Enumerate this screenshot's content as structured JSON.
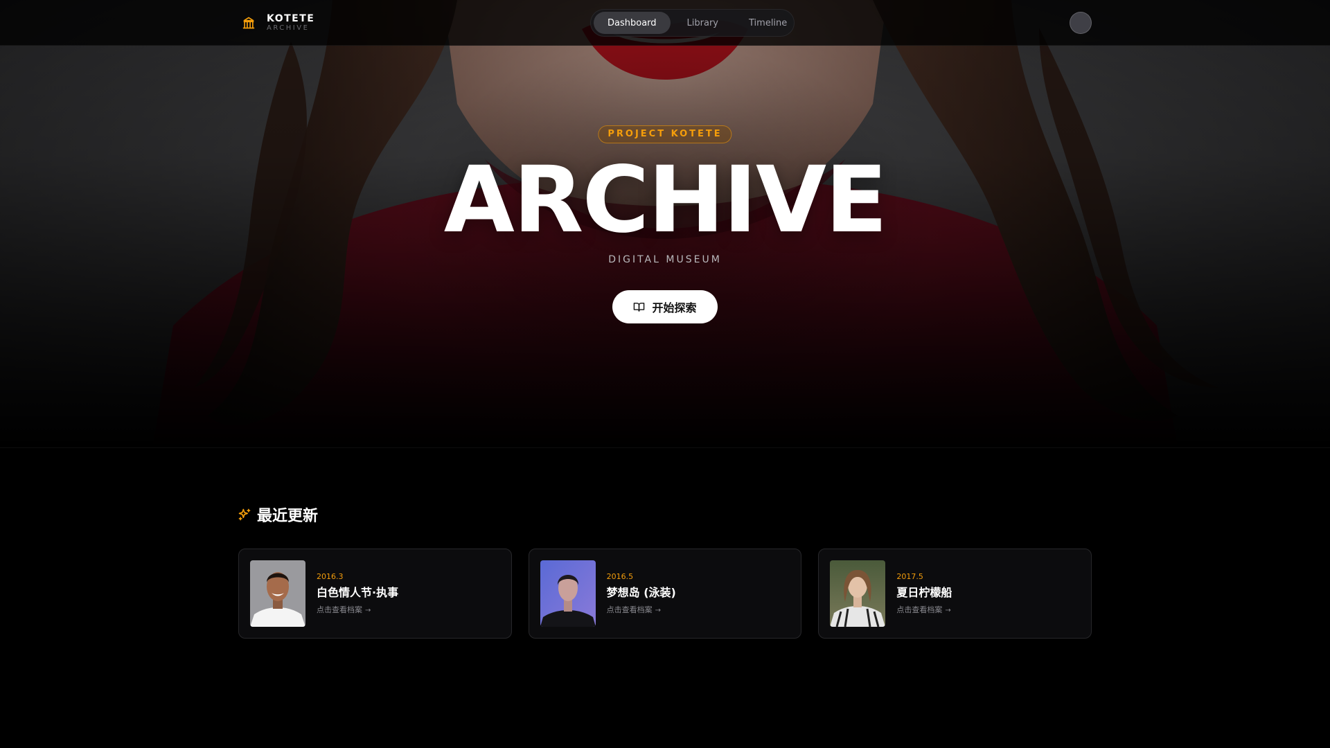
{
  "brand": {
    "name": "KOTETE",
    "subtitle": "ARCHIVE",
    "logo_icon": "library-icon"
  },
  "nav": {
    "tabs": [
      {
        "label": "Dashboard",
        "active": true
      },
      {
        "label": "Library",
        "active": false
      },
      {
        "label": "Timeline",
        "active": false
      }
    ]
  },
  "hero": {
    "badge": "PROJECT KOTETE",
    "title": "ARCHIVE",
    "subtitle": "DIGITAL MUSEUM",
    "cta_label": "开始探索",
    "cta_icon": "book-open-icon"
  },
  "recent": {
    "heading": "最近更新",
    "heading_icon": "sparkles-icon",
    "items": [
      {
        "date": "2016.3",
        "title": "白色情人节·执事",
        "link_label": "点击查看档案",
        "link_icon": "arrow-right-icon"
      },
      {
        "date": "2016.5",
        "title": "梦想岛 (泳装)",
        "link_label": "点击查看档案",
        "link_icon": "arrow-right-icon"
      },
      {
        "date": "2017.5",
        "title": "夏日柠檬船",
        "link_label": "点击查看档案",
        "link_icon": "arrow-right-icon"
      }
    ]
  },
  "colors": {
    "accent": "#f59e0b",
    "background": "#000000",
    "card_bg": "#0c0c0e",
    "card_border": "#27272a"
  }
}
